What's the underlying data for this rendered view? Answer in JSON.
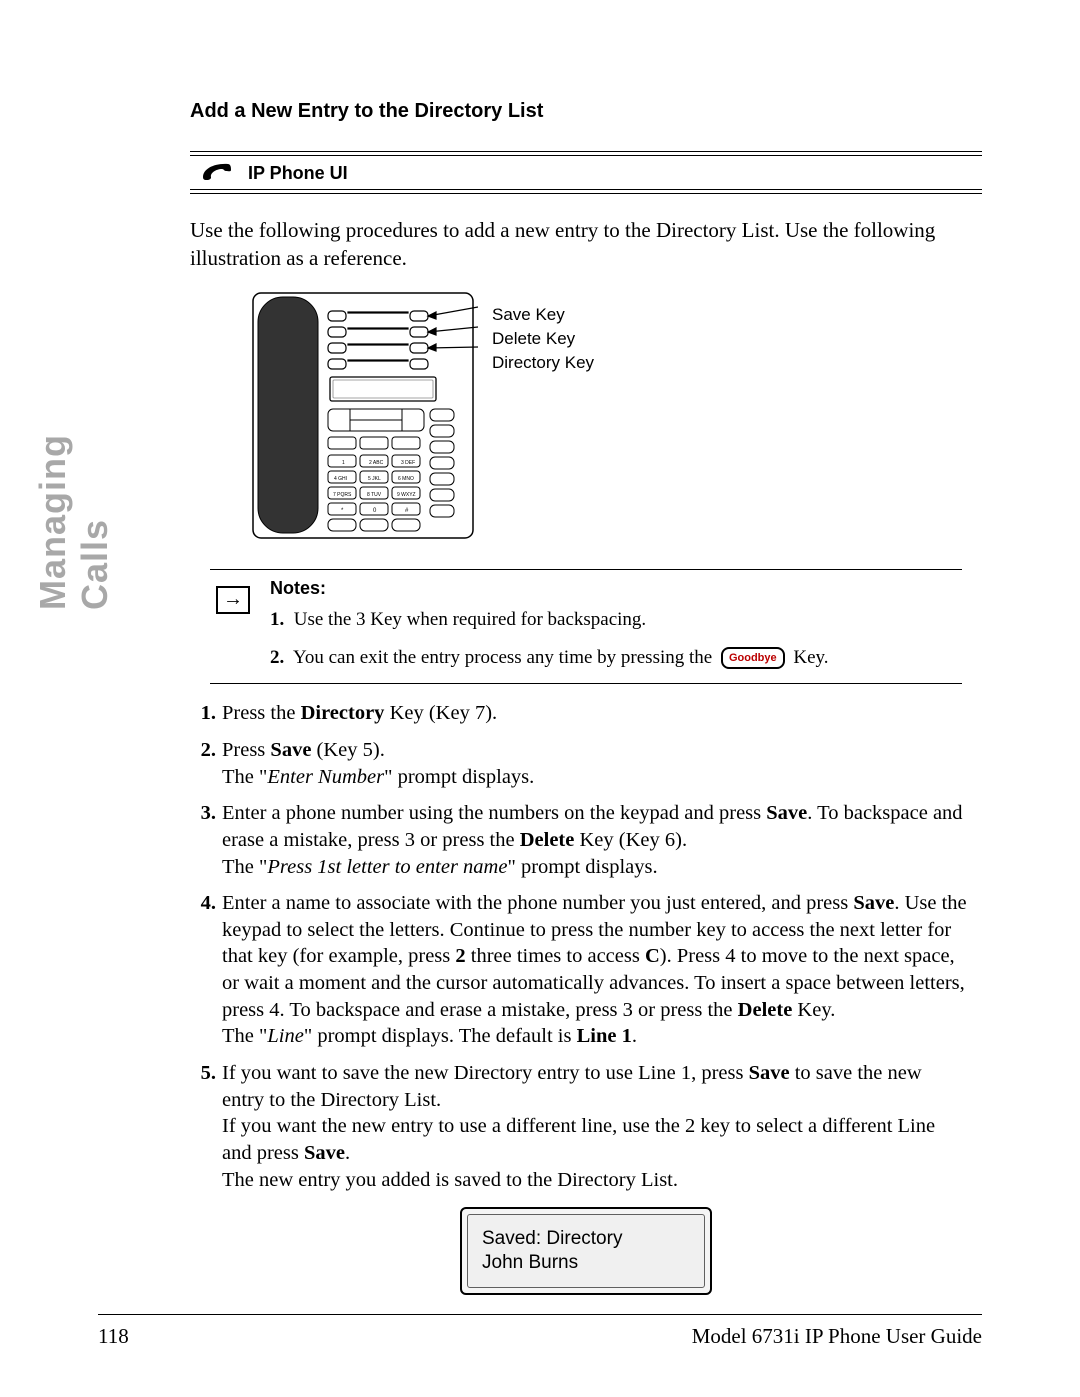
{
  "sideLabel": "Managing Calls",
  "sectionTitle": "Add a New Entry to the Directory List",
  "ipUiLabel": "IP Phone UI",
  "intro": "Use the following procedures to add a new entry to the Directory List. Use the following illustration as a reference.",
  "callouts": {
    "save": "Save Key",
    "delete": "Delete Key",
    "directory": "Directory Key"
  },
  "notes": {
    "heading": "Notes:",
    "item1_pre": "Use the ",
    "item1_key": "3",
    "item1_post": " Key when required for backspacing.",
    "item2_pre": "You can exit the entry process any time by pressing the ",
    "item2_keylabel": "Goodbye",
    "item2_post": " Key."
  },
  "steps": {
    "s1a": "Press the ",
    "s1b": "Directory",
    "s1c": " Key (Key 7).",
    "s2a": "Press ",
    "s2b": "Save",
    "s2c": " (Key 5).",
    "s2d": "The \"",
    "s2e": "Enter Number",
    "s2f": "\" prompt displays.",
    "s3a": "Enter a phone number using the numbers on the keypad and press ",
    "s3b": "Save",
    "s3c": ". To backspace and erase a mistake, press ",
    "s3d": "3",
    "s3e": " or press the ",
    "s3f": "Delete",
    "s3g": " Key (Key 6).",
    "s3h": "The \"",
    "s3i": "Press 1st letter to enter name",
    "s3j": "\" prompt displays.",
    "s4a": "Enter a name to associate with the phone number you just entered, and press ",
    "s4b": "Save",
    "s4c": ". Use the keypad to select the letters. Continue to press the number key to access the next letter for that key (for example, press ",
    "s4d": "2",
    "s4e": " three times to access ",
    "s4f": "C",
    "s4g": "). Press ",
    "s4h": "4",
    "s4i": " to move to the next space, or wait a moment and the cursor automatically advances. To insert a space between letters, press ",
    "s4j": "4",
    "s4k": ". To backspace and erase a mistake, press ",
    "s4l": "3",
    "s4m": " or press the ",
    "s4n": "Delete",
    "s4o": " Key.",
    "s4p": "The \"",
    "s4q": "Line",
    "s4r": "\" prompt displays. The default is ",
    "s4s": "Line 1",
    "s4t": ".",
    "s5a": "If you want to save the new Directory entry to use Line 1, press ",
    "s5b": "Save",
    "s5c": " to save the new entry to the Directory List.",
    "s5d": "If you want the new entry to use a different line, use the ",
    "s5e": "2",
    "s5f": " key to select a different Line and press ",
    "s5g": "Save",
    "s5h": ".",
    "s5i": "The new entry you added is saved to the Directory List."
  },
  "lcd": {
    "line1": "Saved: Directory",
    "line2": "John Burns"
  },
  "footer": {
    "page": "118",
    "title": "Model 6731i IP Phone User Guide"
  }
}
